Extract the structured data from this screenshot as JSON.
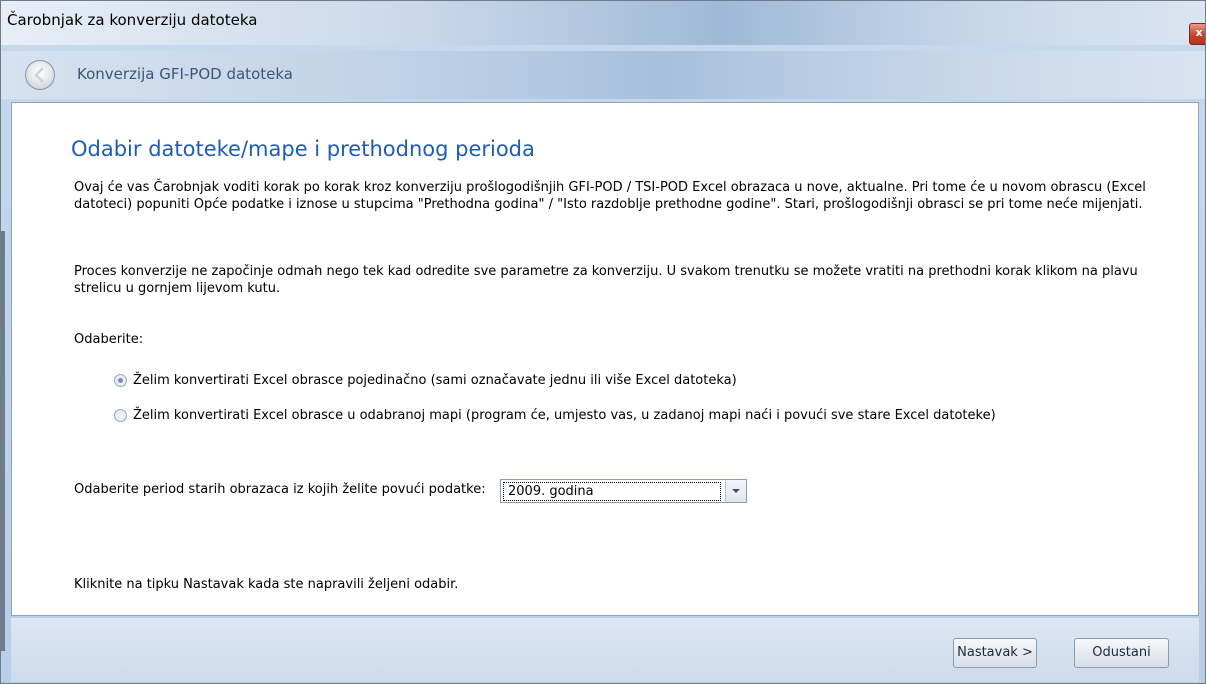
{
  "window": {
    "title": "Čarobnjak za konverziju datoteka",
    "close_label": "x"
  },
  "nav": {
    "title": "Konverzija GFI-POD datoteka",
    "back_icon": "back-arrow-icon"
  },
  "content": {
    "heading": "Odabir datoteke/mape i prethodnog perioda",
    "paragraph1": "Ovaj će vas Čarobnjak voditi korak po korak kroz konverziju prošlogodišnjih GFI-POD / TSI-POD Excel obrazaca u nove, aktualne. Pri tome će u novom obrascu (Excel datoteci) popuniti Opće podatke i iznose u stupcima \"Prethodna godina\" / \"Isto razdoblje prethodne godine\". Stari, prošlogodišnji obrasci se pri tome neće mijenjati.",
    "paragraph2": "Proces konverzije ne započinje odmah nego tek kad odredite sve parametre za konverziju. U svakom trenutku se možete vratiti na prethodni korak klikom na plavu strelicu u gornjem lijevom kutu.",
    "choose_label": "Odaberite:",
    "options": [
      {
        "label": "Želim konvertirati Excel obrasce pojedinačno (sami označavate jednu ili više Excel datoteka)",
        "checked": true
      },
      {
        "label": "Želim konvertirati Excel obrasce u odabranoj mapi (program će, umjesto vas, u zadanoj mapi naći i povući sve stare Excel datoteke)",
        "checked": false
      }
    ],
    "period_label": "Odaberite period starih obrazaca iz kojih želite povući podatke:",
    "period_value": "2009. godina",
    "hint": "Kliknite na tipku Nastavak kada ste napravili željeni odabir."
  },
  "footer": {
    "next_label": "Nastavak >",
    "cancel_label": "Odustani"
  }
}
